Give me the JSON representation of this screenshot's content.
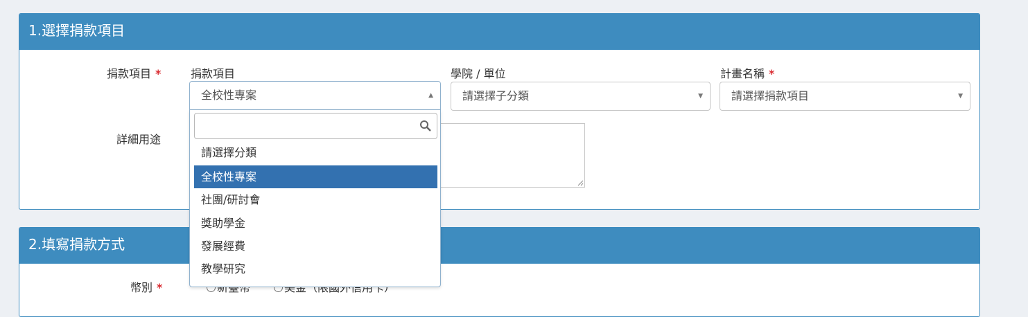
{
  "section1": {
    "title": "1.選擇捐款項目",
    "row_label": "捐款項目",
    "purpose_label": "詳細用途",
    "donation_item": {
      "label": "捐款項目",
      "value": "全校性專案"
    },
    "college": {
      "label": "學院 / 單位",
      "value": "請選擇子分類"
    },
    "project": {
      "label": "計畫名稱",
      "value": "請選擇捐款項目"
    },
    "required_mark": "*",
    "dropdown": {
      "search_value": "",
      "options": [
        "請選擇分類",
        "全校性專案",
        "社團/研討會",
        "獎助學金",
        "發展經費",
        "教學研究"
      ],
      "highlighted": "全校性專案"
    }
  },
  "section2": {
    "title": "2.填寫捐款方式",
    "currency_label": "幣別",
    "currency_options": [
      "新臺幣",
      "美金（限國外信用卡）"
    ]
  },
  "colors": {
    "header": "#3e8cbf",
    "highlight": "#3371b0",
    "required": "#d9292f",
    "background": "#edf0f4"
  }
}
